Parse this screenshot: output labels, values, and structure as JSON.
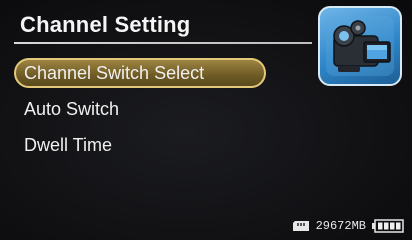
{
  "header": {
    "title": "Channel Setting",
    "icon": "video-camera-icon"
  },
  "menu": {
    "items": [
      {
        "label": "Channel Switch Select",
        "selected": true
      },
      {
        "label": "Auto Switch",
        "selected": false
      },
      {
        "label": "Dwell Time",
        "selected": false
      }
    ]
  },
  "status_bar": {
    "storage_icon": "sd-card-icon",
    "free_space": "29672MB",
    "battery_icon": "battery-icon",
    "battery_level": 1.0
  },
  "colors": {
    "highlight": "#7a6429",
    "highlight_border": "#e3c97a",
    "icon_blue": "#2f86c9"
  }
}
